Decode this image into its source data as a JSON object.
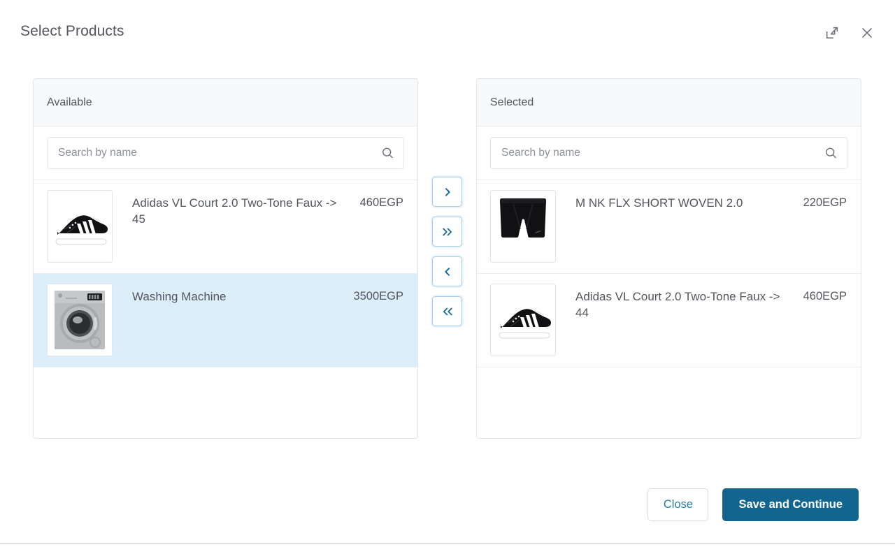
{
  "dialog": {
    "title": "Select Products",
    "expand_icon": "expand-icon",
    "close_icon": "close-icon"
  },
  "available_panel": {
    "title": "Available",
    "search": {
      "placeholder": "Search by name",
      "value": "",
      "icon": "search-icon"
    },
    "items": [
      {
        "name": "Adidas VL Court 2.0 Two-Tone Faux -> 45",
        "price": "460EGP",
        "image": "black-sneaker-white-stripes",
        "selected": false
      },
      {
        "name": "Washing Machine",
        "price": "3500EGP",
        "image": "silver-front-load-washing-machine",
        "selected": true
      }
    ]
  },
  "transfer_controls": [
    {
      "name": "move-right-button",
      "glyph": "chevron-right"
    },
    {
      "name": "move-all-right-button",
      "glyph": "chevron-double-right"
    },
    {
      "name": "move-left-button",
      "glyph": "chevron-left"
    },
    {
      "name": "move-all-left-button",
      "glyph": "chevron-double-left"
    }
  ],
  "selected_panel": {
    "title": "Selected",
    "search": {
      "placeholder": "Search by name",
      "value": "",
      "icon": "search-icon"
    },
    "items": [
      {
        "name": "M NK FLX SHORT WOVEN 2.0",
        "price": "220EGP",
        "image": "black-athletic-shorts",
        "selected": false
      },
      {
        "name": "Adidas VL Court 2.0 Two-Tone Faux -> 44",
        "price": "460EGP",
        "image": "black-sneaker-white-stripes",
        "selected": false
      }
    ]
  },
  "footer": {
    "close_label": "Close",
    "save_label": "Save and Continue"
  },
  "colors": {
    "primary": "#12658f",
    "secondary_text": "#2a7ba5",
    "row_selected_bg": "#ddeefb",
    "panel_head_bg": "#f8f9fa",
    "text": "#53565c",
    "border": "#e3e6e8"
  }
}
